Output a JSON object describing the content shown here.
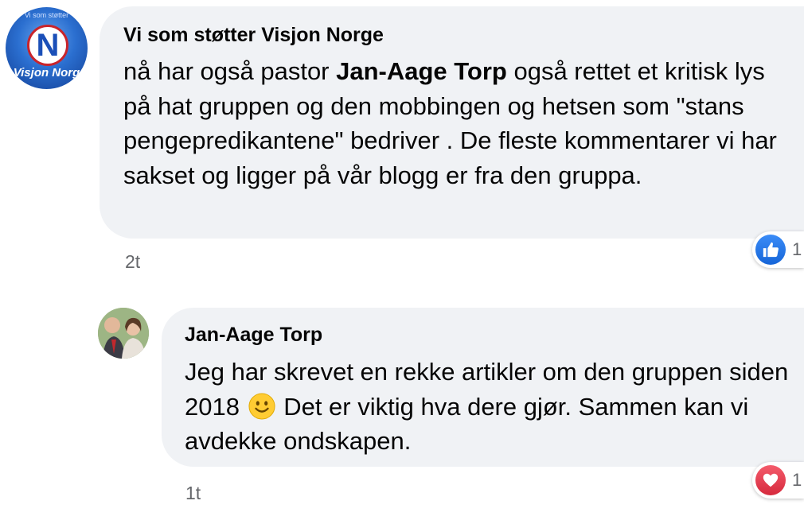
{
  "comment1": {
    "avatar_small_text": "Vi som støtter",
    "avatar_logo_letter": "N",
    "avatar_logo_text": "Visjon Norg",
    "author": "Vi som støtter Visjon Norge",
    "text_before": "nå har også pastor ",
    "text_bold": "Jan-Aage Torp",
    "text_after": " også rettet et kritisk lys på hat gruppen og den mobbingen og hetsen som \"stans pengepredikantene\" bedriver .  De fleste kommentarer vi har sakset og ligger på vår blogg er fra den gruppa.",
    "time": "2t",
    "reaction_icon": "like-icon",
    "reaction_count": "1"
  },
  "comment2": {
    "author": "Jan-Aage Torp",
    "text_before": "Jeg har skrevet en rekke artikler om den gruppen siden 2018",
    "emoji": "smiling-face-emoji",
    "text_after": " Det er viktig hva dere gjør. Sammen kan vi avdekke ondskapen.",
    "time": "1t",
    "reaction_icon": "heart-icon",
    "reaction_count": "1"
  },
  "colors": {
    "bubble": "#f0f2f5",
    "like_blue": "#1877f2",
    "heart_red": "#f33e58",
    "meta_gray": "#65676b"
  }
}
